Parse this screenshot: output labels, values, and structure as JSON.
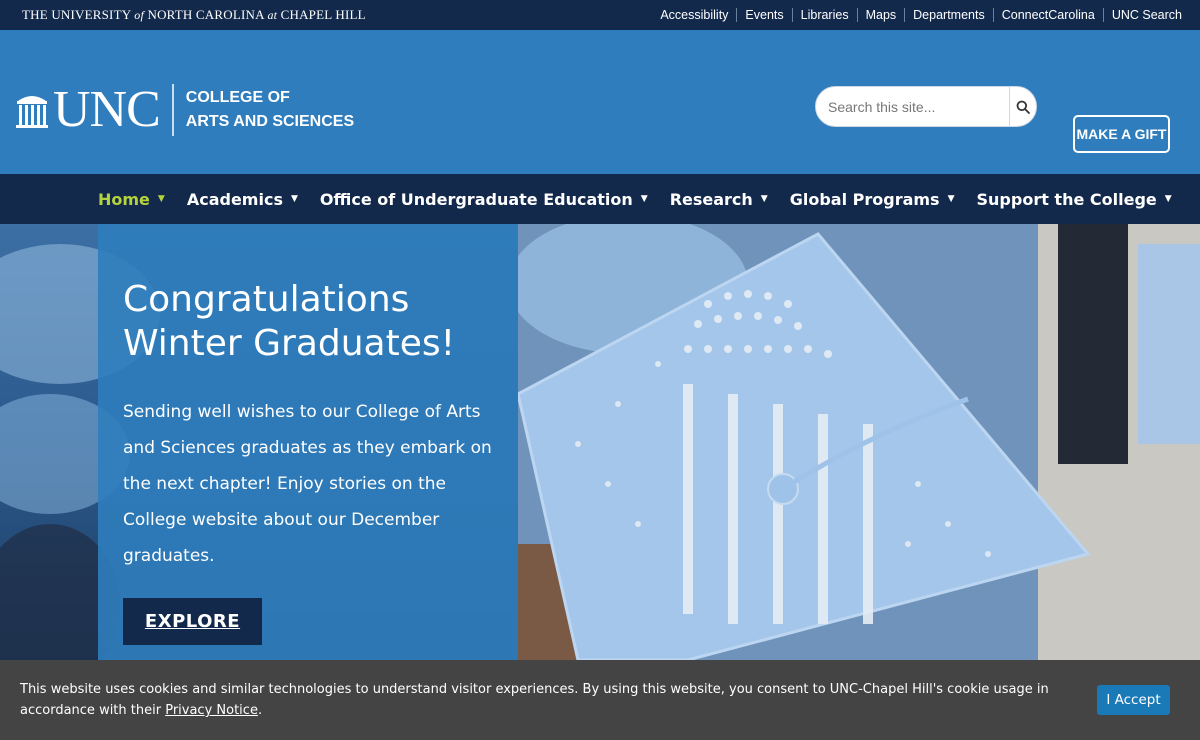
{
  "topbar": {
    "university_name_parts": [
      "THE UNIVERSITY",
      "of",
      "NORTH CAROLINA",
      "at",
      "CHAPEL HILL"
    ],
    "links": [
      "Accessibility",
      "Events",
      "Libraries",
      "Maps",
      "Departments",
      "ConnectCarolina",
      "UNC Search"
    ]
  },
  "header": {
    "logo_text": "UNC",
    "college_line1": "COLLEGE OF",
    "college_line2": "ARTS AND SCIENCES",
    "search_placeholder": "Search this site...",
    "gift_label": "MAKE A GIFT"
  },
  "nav": {
    "items": [
      {
        "label": "Home",
        "active": true
      },
      {
        "label": "Academics",
        "active": false
      },
      {
        "label": "Office of Undergraduate Education",
        "active": false
      },
      {
        "label": "Research",
        "active": false
      },
      {
        "label": "Global Programs",
        "active": false
      },
      {
        "label": "Support the College",
        "active": false
      }
    ],
    "caret": "▼",
    "active_color": "#b5d33d"
  },
  "hero": {
    "title_line1": "Congratulations",
    "title_line2": "Winter Graduates!",
    "body": "Sending well wishes to our College of Arts and Sciences graduates as they embark on the next chapter! Enjoy stories on the College website about our December graduates.",
    "button_label": "EXPLORE"
  },
  "cookie": {
    "text_before": "This website uses cookies and similar technologies to understand visitor experiences. By using this website, you consent to UNC-Chapel Hill's cookie usage in accordance with their ",
    "link_label": "Privacy Notice",
    "text_after": ".",
    "accept_label": "I Accept"
  },
  "colors": {
    "navy": "#13294b",
    "carolina_blue": "#2f7dbd",
    "accept_blue": "#1a7ab8"
  }
}
